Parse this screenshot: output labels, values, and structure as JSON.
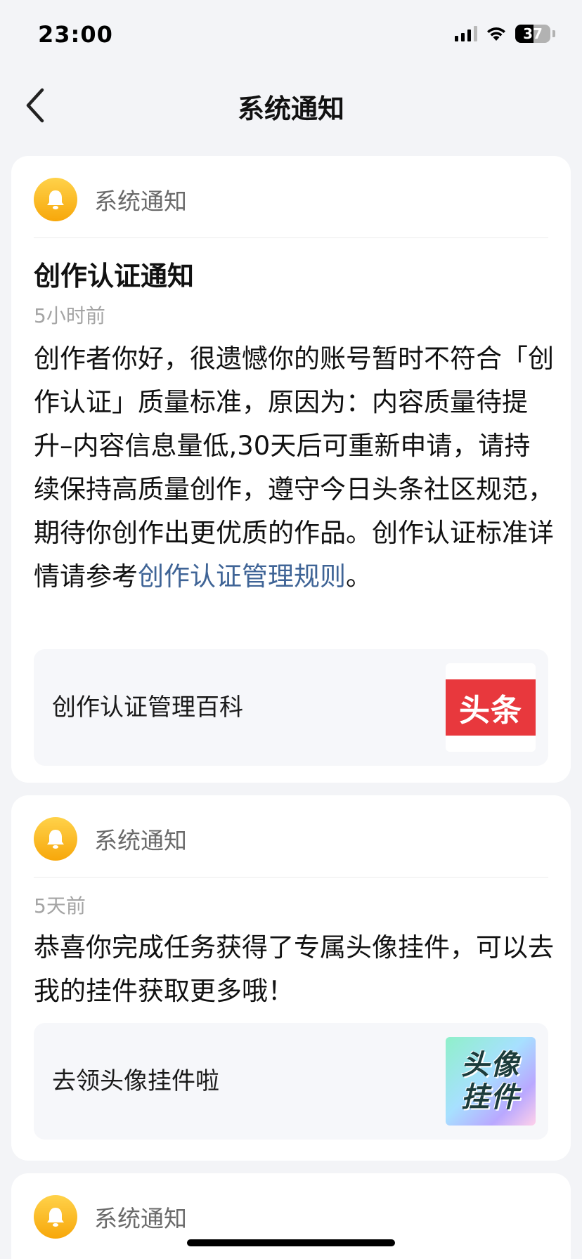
{
  "status_bar": {
    "time": "23:00",
    "battery_level": "37",
    "icons": [
      "signal-icon",
      "wifi-icon",
      "battery-icon"
    ]
  },
  "nav": {
    "title": "系统通知",
    "back_icon": "chevron-left-icon"
  },
  "notifications": [
    {
      "source": "系统通知",
      "title": "创作认证通知",
      "time": "5小时前",
      "body": "创作者你好，很遗憾你的账号暂时不符合「创作认证」质量标准，原因为：内容质量待提升–内容信息量低,30天后可重新申请，请持续保持高质量创作，遵守今日头条社区规范，期待你创作出更优质的作品。创作认证标准详情请参考",
      "link": "创作认证管理规则",
      "body_end": "。",
      "attachment": {
        "label": "创作认证管理百科",
        "thumb_text": "头条"
      }
    },
    {
      "source": "系统通知",
      "time": "5天前",
      "body": "恭喜你完成任务获得了专属头像挂件，可以去我的挂件获取更多哦！",
      "attachment": {
        "label": "去领头像挂件啦",
        "thumb_line1": "头像",
        "thumb_line2": "挂件"
      }
    },
    {
      "source": "系统通知"
    }
  ],
  "colors": {
    "background": "#f3f4f7",
    "link": "#3f6496",
    "bell_gradient_top": "#ffd24a",
    "bell_gradient_bottom": "#f7a70a",
    "toutiao_red": "#e8383d"
  }
}
